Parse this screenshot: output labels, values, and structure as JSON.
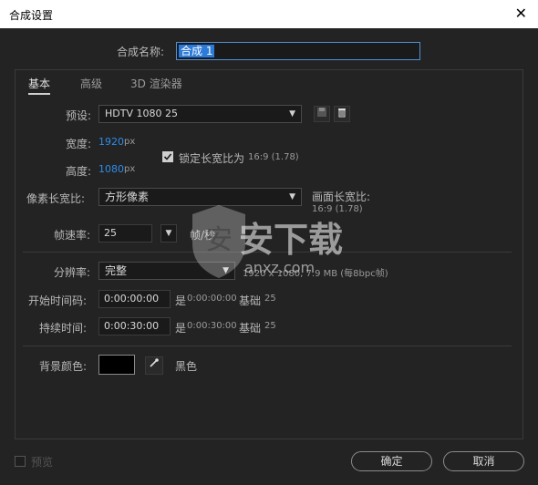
{
  "window": {
    "title": "合成设置",
    "close_glyph": "✕"
  },
  "comp_name": {
    "label": "合成名称:",
    "value": "合成 1"
  },
  "tabs": [
    {
      "label": "基本"
    },
    {
      "label": "高级"
    },
    {
      "label": "3D 渲染器"
    }
  ],
  "preset": {
    "label": "预设:",
    "value": "HDTV 1080 25"
  },
  "width": {
    "label": "宽度:",
    "value": "1920",
    "unit": "px"
  },
  "height": {
    "label": "高度:",
    "value": "1080",
    "unit": "px"
  },
  "lock_aspect": {
    "label": "锁定长宽比为",
    "ratio": "16:9 (1.78)",
    "checked": true
  },
  "pixel_aspect": {
    "label": "像素长宽比:",
    "value": "方形像素"
  },
  "frame_aspect": {
    "label": "画面长宽比:",
    "value": "16:9 (1.78)"
  },
  "frame_rate": {
    "label": "帧速率:",
    "value": "25",
    "unit": "帧/秒"
  },
  "resolution": {
    "label": "分辨率:",
    "value": "完整",
    "info": "1920 x 1080, 7.9 MB (每8bpc帧)"
  },
  "start_timecode": {
    "label": "开始时间码:",
    "value": "0:00:00:00",
    "is_label": "是",
    "is_value": "0:00:00:00",
    "base_label": "基础",
    "base_value": "25"
  },
  "duration": {
    "label": "持续时间:",
    "value": "0:00:30:00",
    "is_label": "是",
    "is_value": "0:00:30:00",
    "base_label": "基础",
    "base_value": "25"
  },
  "bg_color": {
    "label": "背景颜色:",
    "name": "黑色",
    "swatch": "#000000"
  },
  "preview": {
    "label": "预览",
    "checked": false
  },
  "buttons": {
    "ok": "确定",
    "cancel": "取消"
  },
  "watermark": {
    "text": "安下载",
    "sub": "anxz.com"
  },
  "colors": {
    "accent": "#2d8ceb",
    "background": "#232323"
  }
}
